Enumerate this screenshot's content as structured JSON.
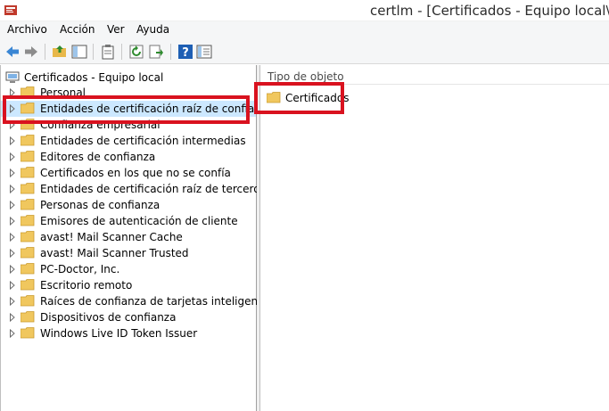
{
  "window": {
    "title": "certlm - [Certificados - Equipo local\\Enti"
  },
  "menu": {
    "items": [
      "Archivo",
      "Acción",
      "Ver",
      "Ayuda"
    ]
  },
  "toolbar": {
    "buttons": [
      "back-arrow-icon",
      "forward-arrow-icon",
      "up-folder-icon",
      "show-hide-tree-icon",
      "clipboard-icon",
      "refresh-icon",
      "export-list-icon",
      "help-icon",
      "properties-icon"
    ]
  },
  "tree": {
    "root": "Certificados - Equipo local",
    "items": [
      "Personal",
      "Entidades de certificación raíz de confianza",
      "Confianza empresarial",
      "Entidades de certificación intermedias",
      "Editores de confianza",
      "Certificados en los que no se confía",
      "Entidades de certificación raíz de terceros",
      "Personas de confianza",
      "Emisores de autenticación de cliente",
      "avast! Mail Scanner Cache",
      "avast! Mail Scanner Trusted",
      "PC-Doctor, Inc.",
      "Escritorio remoto",
      "Raíces de confianza de tarjetas inteligentes",
      "Dispositivos de confianza",
      "Windows Live ID Token Issuer"
    ],
    "selected_index": 1
  },
  "list": {
    "column_header": "Tipo de objeto",
    "items": [
      "Certificados"
    ]
  },
  "colors": {
    "highlight": "#d9121f",
    "selection": "#cce8ff",
    "folder": "#f0c75e"
  }
}
